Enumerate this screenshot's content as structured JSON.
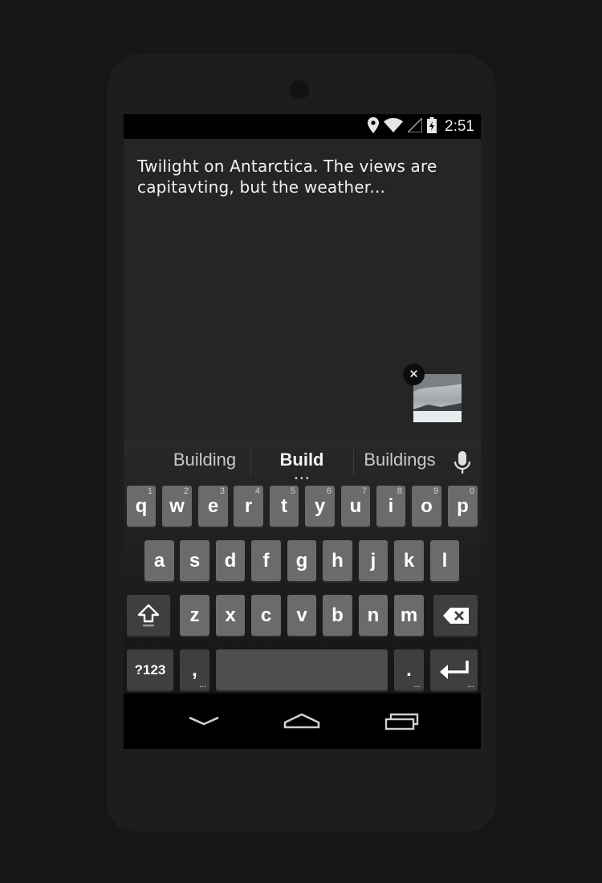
{
  "status_bar": {
    "time": "2:51",
    "icons": [
      "location-pin-icon",
      "wifi-icon",
      "signal-icon",
      "battery-icon"
    ]
  },
  "post": {
    "text": "Twilight on Antarctica. The views are capitavting, but the weather..."
  },
  "attachment": {
    "remove_symbol": "✕"
  },
  "suggestions": {
    "left": "Building",
    "center": "Build",
    "right": "Buildings",
    "more_dots": "•••"
  },
  "keyboard": {
    "row1": [
      {
        "label": "q",
        "hint": "1"
      },
      {
        "label": "w",
        "hint": "2"
      },
      {
        "label": "e",
        "hint": "3"
      },
      {
        "label": "r",
        "hint": "4"
      },
      {
        "label": "t",
        "hint": "5"
      },
      {
        "label": "y",
        "hint": "6"
      },
      {
        "label": "u",
        "hint": "7"
      },
      {
        "label": "i",
        "hint": "8"
      },
      {
        "label": "o",
        "hint": "9"
      },
      {
        "label": "p",
        "hint": "0"
      }
    ],
    "row2": [
      "a",
      "s",
      "d",
      "f",
      "g",
      "h",
      "j",
      "k",
      "l"
    ],
    "row3": [
      "z",
      "x",
      "c",
      "v",
      "b",
      "n",
      "m"
    ],
    "symbols_label": "?123",
    "comma_label": ",",
    "period_label": ".",
    "ellipsis": "…"
  },
  "colors": {
    "key": "#6b6b6b",
    "key_dark": "#3f3f3f",
    "background": "#252525"
  }
}
